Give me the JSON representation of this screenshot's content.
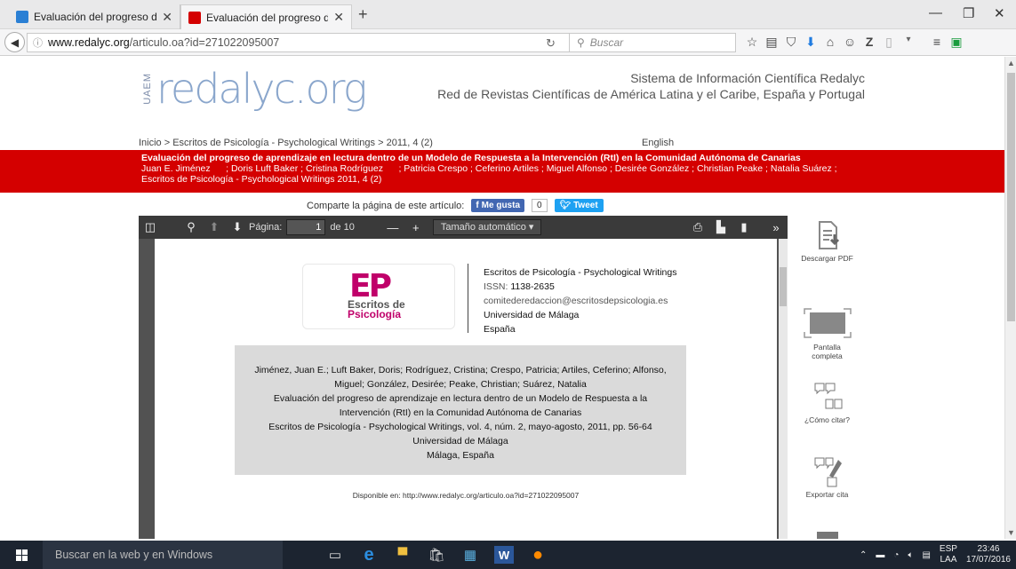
{
  "tabs": [
    {
      "title": "Evaluación del progreso d...",
      "active": false
    },
    {
      "title": "Evaluación del progreso d...",
      "active": true
    }
  ],
  "url": {
    "domain": "www.redalyc.org",
    "path": "/articulo.oa?id=271022095007"
  },
  "search_placeholder": "Buscar",
  "header": {
    "uaem": "UAEM",
    "logo": "redalyc.org",
    "line1": "Sistema de Información Científica Redalyc",
    "line2": "Red de Revistas Científicas de América Latina y el Caribe, España y Portugal"
  },
  "breadcrumb": "Inicio > Escritos de Psicología - Psychological Writings > 2011, 4 (2)",
  "english_link": "English",
  "article": {
    "title": "Evaluación del progreso de aprendizaje en lectura dentro de un Modelo de Respuesta a la Intervención (RtI) en la Comunidad Autónoma de Canarias",
    "authors": "Juan E. Jiménez      ; Doris Luft Baker ; Cristina Rodríguez      ; Patricia Crespo ; Ceferino Artiles ; Miguel Alfonso ; Desirée González ; Christian Peake ; Natalia Suárez ;",
    "journal": "Escritos de Psicología - Psychological Writings 2011, 4 (2)"
  },
  "share": {
    "label": "Comparte la página de este artículo:",
    "fb": "Me gusta",
    "fb_count": "0",
    "tw": "Tweet"
  },
  "pdf": {
    "page_label": "Página:",
    "page": "1",
    "of": "de 10",
    "zoom": "Tamaño automático"
  },
  "doc": {
    "logo_ep": "EP",
    "logo_es1": "Escritos de",
    "logo_es2": "Psicología",
    "journal": "Escritos de Psicología - Psychological Writings",
    "issn_label": "ISSN:",
    "issn": "1138-2635",
    "email": "comitederedaccion@escritosdepsicologia.es",
    "univ": "Universidad de Málaga",
    "country": "España",
    "cite": [
      "Jiménez, Juan E.; Luft Baker, Doris; Rodríguez, Cristina; Crespo, Patricia; Artiles, Ceferino; Alfonso,",
      "Miguel; González, Desirée; Peake, Christian; Suárez, Natalia",
      "Evaluación del progreso de aprendizaje en lectura dentro de un Modelo de Respuesta a la",
      "Intervención (RtI) en la Comunidad Autónoma de Canarias",
      "Escritos de Psicología - Psychological Writings, vol. 4, núm. 2, mayo-agosto, 2011, pp. 56-64",
      "Universidad de Málaga",
      "Málaga, España"
    ],
    "available": "Disponible en: http://www.redalyc.org/articulo.oa?id=271022095007"
  },
  "side": {
    "download": "Descargar PDF",
    "fullscreen": "Pantalla completa",
    "cite": "¿Cómo citar?",
    "export": "Exportar cita"
  },
  "taskbar": {
    "search": "Buscar en la web y en Windows",
    "lang1": "ESP",
    "lang2": "LAA",
    "time": "23:46",
    "date": "17/07/2016"
  },
  "colors": {
    "red_bar": "#d40000",
    "pdf_toolbar": "#3a3a3a",
    "taskbar": "#1c2430"
  }
}
